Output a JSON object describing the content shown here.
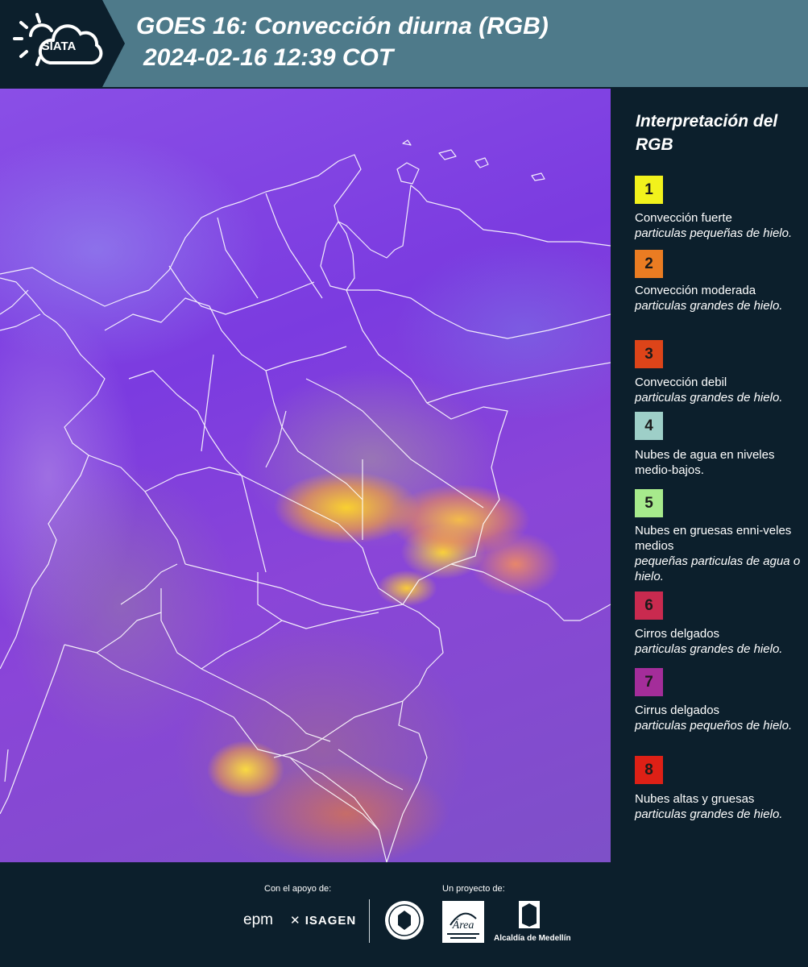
{
  "header": {
    "logo_text": "SIATA",
    "title_line1": "GOES 16: Convección diurna (RGB)",
    "title_line2": "2024-02-16 12:39 COT"
  },
  "legend": {
    "title": "Interpretación del RGB",
    "items": [
      {
        "number": "1",
        "color": "#f2f21c",
        "main": "Convección fuerte",
        "sub": "particulas pequeñas de hielo."
      },
      {
        "number": "2",
        "color": "#ea7c22",
        "main": "Convección moderada",
        "sub": "particulas grandes de hielo."
      },
      {
        "number": "3",
        "color": "#dd4419",
        "main": "Convección debil",
        "sub": "particulas grandes de hielo."
      },
      {
        "number": "4",
        "color": "#9ecfc8",
        "main": "Nubes de agua en niveles medio-bajos.",
        "sub": ""
      },
      {
        "number": "5",
        "color": "#a7ea8c",
        "main": "Nubes en gruesas enni-veles medios",
        "sub": "pequeñas particulas de agua o hielo."
      },
      {
        "number": "6",
        "color": "#c92a4f",
        "main": "Cirros delgados",
        "sub": "particulas grandes de hielo."
      },
      {
        "number": "7",
        "color": "#a42d9a",
        "main": "Cirrus delgados",
        "sub": "particulas pequeños de hielo."
      },
      {
        "number": "8",
        "color": "#de2016",
        "main": "Nubes altas y gruesas",
        "sub": "particulas grandes de hielo."
      }
    ]
  },
  "footer": {
    "support_label": "Con el apoyo de:",
    "project_label": "Un proyecto de:",
    "sponsors": [
      "epm",
      "ISAGEN"
    ],
    "amva_text": "Área",
    "alcaldia_text": "Alcaldía de Medellín"
  }
}
